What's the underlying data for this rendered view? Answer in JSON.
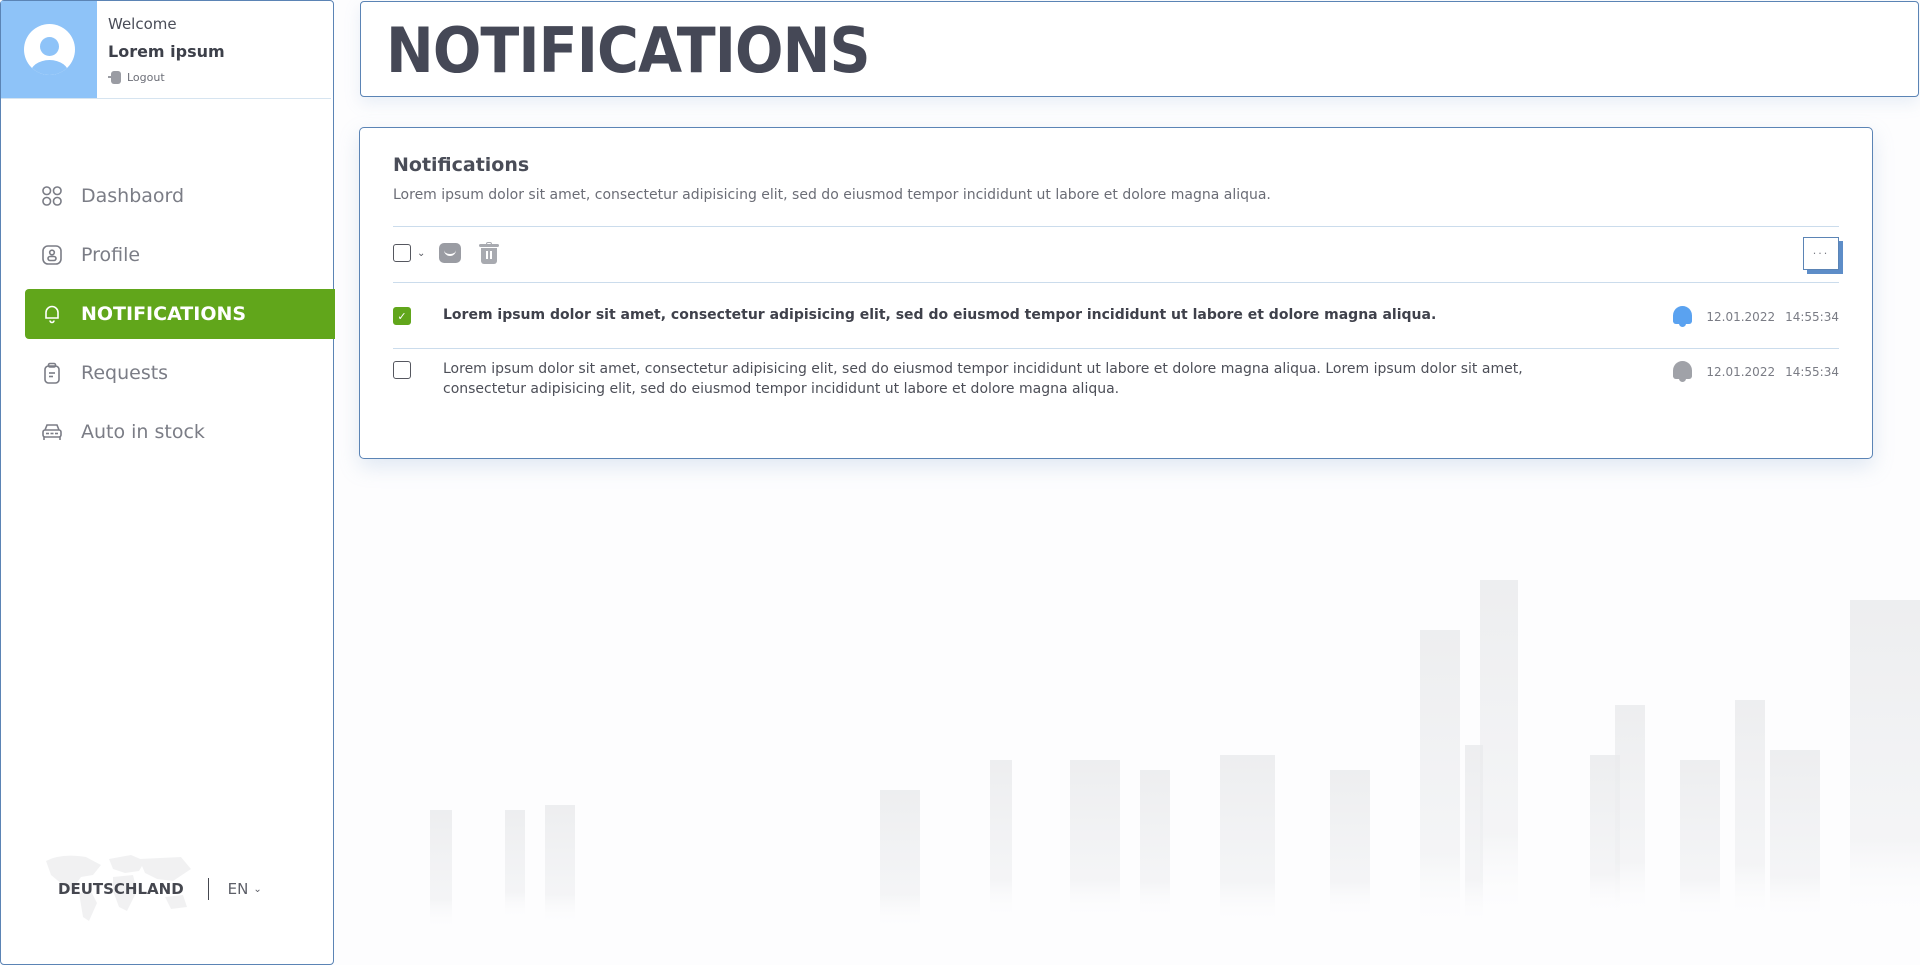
{
  "user": {
    "welcome": "Welcome",
    "name": "Lorem ipsum",
    "logout_label": "Logout",
    "avatar_color": "#8ec3f8"
  },
  "sidebar": {
    "items": [
      {
        "label": "Dashbaord",
        "icon": "grid-icon",
        "active": false
      },
      {
        "label": "Profile",
        "icon": "profile-badge-icon",
        "active": false
      },
      {
        "label": "NOTIFICATIONS",
        "icon": "bell-icon",
        "active": true
      },
      {
        "label": "Requests",
        "icon": "clipboard-icon",
        "active": false
      },
      {
        "label": "Auto in stock",
        "icon": "car-icon",
        "active": false
      }
    ],
    "active_color": "#61a61b"
  },
  "locale": {
    "country": "DEUTSCHLAND",
    "language": "EN"
  },
  "header": {
    "title": "NOTIFICATIONS"
  },
  "card": {
    "title": "Notifications",
    "description": "Lorem ipsum dolor sit amet, consectetur adipisicing elit, sed do eiusmod tempor incididunt ut labore et dolore magna aliqua.",
    "toolbar": {
      "select_all_checked": false,
      "more_label": "···"
    },
    "notifications": [
      {
        "checked": true,
        "unread": true,
        "text": "Lorem ipsum dolor sit amet, consectetur adipisicing elit, sed do eiusmod tempor incididunt ut labore et dolore magna aliqua.",
        "date": "12.01.2022",
        "time": "14:55:34",
        "bell_color": "#5aa2f0"
      },
      {
        "checked": false,
        "unread": false,
        "text": "Lorem ipsum dolor sit amet, consectetur adipisicing elit, sed do eiusmod tempor incididunt ut labore et dolore magna aliqua. Lorem ipsum dolor sit amet, consectetur adipisicing elit, sed do eiusmod tempor incididunt ut labore et dolore magna aliqua.",
        "date": "12.01.2022",
        "time": "14:55:34",
        "bell_color": "#a0a2a8"
      }
    ]
  }
}
